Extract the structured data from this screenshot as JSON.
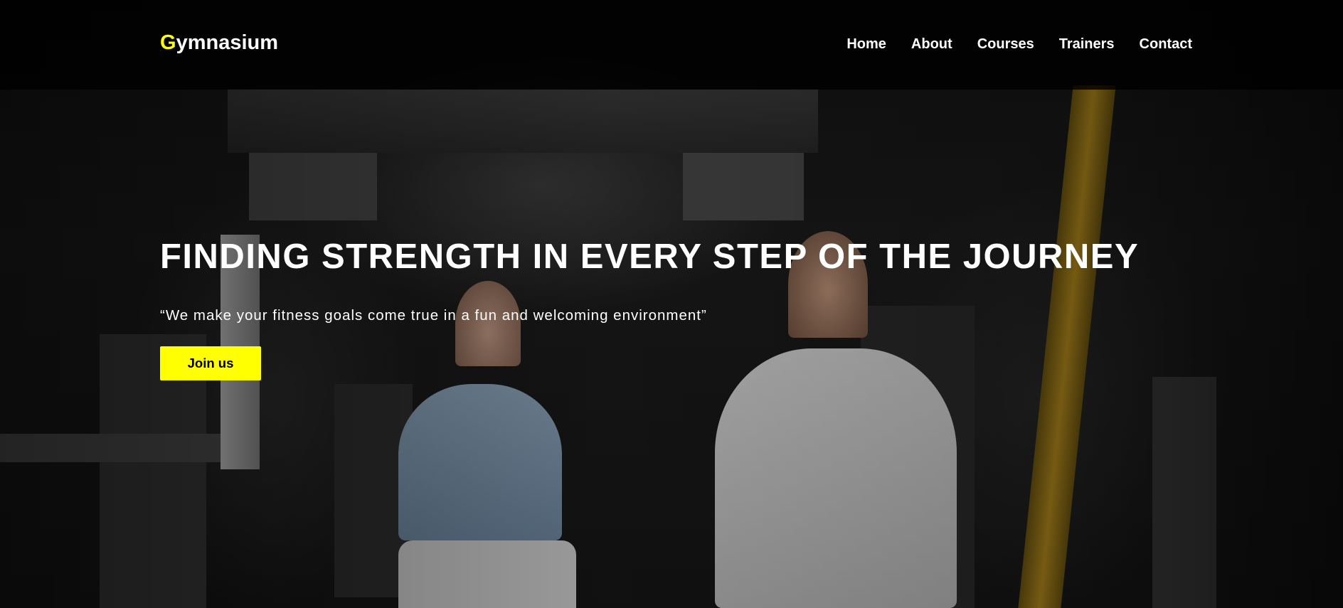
{
  "brand": {
    "logo_initial": "G",
    "logo_rest": "ymnasium",
    "accent_color": "#ffff00"
  },
  "nav": {
    "links": [
      "Home",
      "About",
      "Courses",
      "Trainers",
      "Contact"
    ]
  },
  "hero": {
    "headline": "FINDING STRENGTH IN EVERY STEP OF THE JOURNEY",
    "tagline": "“We make your fitness goals come true in a fun and welcoming environment”",
    "cta_label": "Join us",
    "background_image": "gym interior with two people doing squats"
  }
}
